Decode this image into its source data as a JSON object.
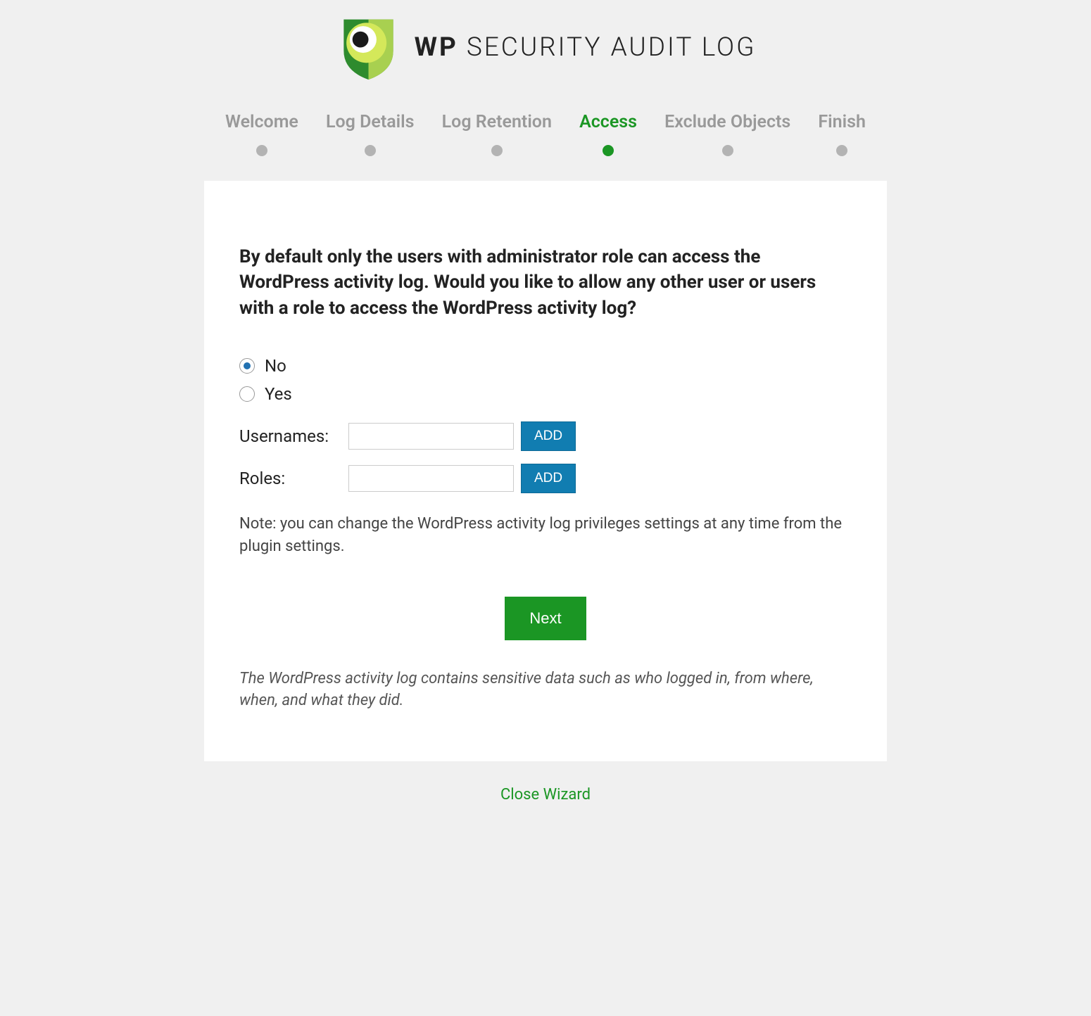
{
  "logo": {
    "bold": "WP",
    "rest": " SECURITY AUDIT LOG"
  },
  "steps": [
    {
      "label": "Welcome",
      "active": false
    },
    {
      "label": "Log Details",
      "active": false
    },
    {
      "label": "Log Retention",
      "active": false
    },
    {
      "label": "Access",
      "active": true
    },
    {
      "label": "Exclude Objects",
      "active": false
    },
    {
      "label": "Finish",
      "active": false
    }
  ],
  "question": "By default only the users with administrator role can access the WordPress activity log. Would you like to allow any other user or users with a role to access the WordPress activity log?",
  "options": {
    "no": "No",
    "yes": "Yes"
  },
  "fields": {
    "usernames_label": "Usernames:",
    "usernames_value": "",
    "roles_label": "Roles:",
    "roles_value": "",
    "add_button": "ADD"
  },
  "note": "Note: you can change the WordPress activity log privileges settings at any time from the plugin settings.",
  "next_button": "Next",
  "caption": "The WordPress activity log contains sensitive data such as who logged in, from where, when, and what they did.",
  "close_link": "Close Wizard"
}
